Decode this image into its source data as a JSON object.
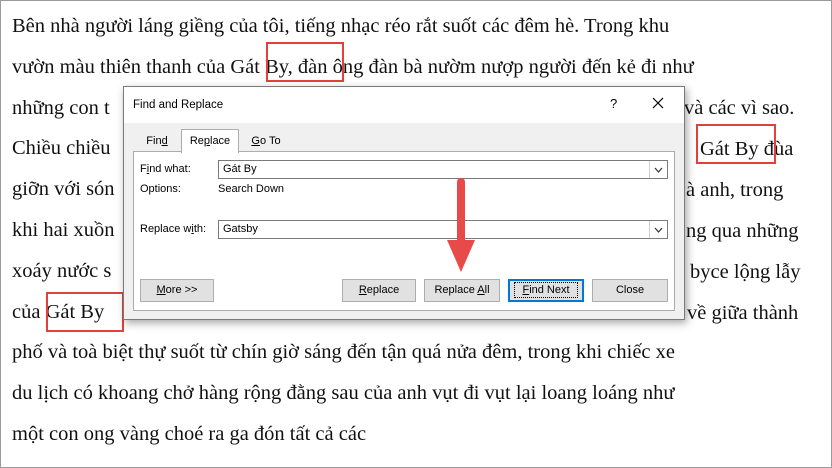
{
  "document": {
    "lines": [
      "Bên nhà người láng giềng của tôi, tiếng nhạc réo rắt suốt các đêm hè. Trong khu",
      "vườn màu thiên thanh của Gát By, đàn ông đàn bà nườm nượp người đến kẻ đi như",
      "những con t",
      "Chiều chiều",
      "giỡn với són",
      "khi hai xuồn",
      "xoáy nước s",
      "của Gát By",
      "phố và toà biệt thự suốt từ chín giờ sáng đến tận quá nửa đêm, trong khi chiếc xe",
      "du lịch có khoang chở hàng rộng đằng sau của anh vụt đi vụt lại loang loáng như",
      "một con ong vàng choé ra ga đón tất cả các"
    ],
    "right_fragments": [
      {
        "line": 2,
        "text": " và các vì sao."
      },
      {
        "line": 3,
        "text": "Gát By đùa"
      },
      {
        "line": 4,
        "text": "à anh, trong"
      },
      {
        "line": 5,
        "text": "ng qua những"
      },
      {
        "line": 6,
        "text": "byce lộng lẫy"
      },
      {
        "line": 7,
        "text": "về giữa thành"
      }
    ]
  },
  "dialog": {
    "title": "Find and Replace",
    "help": "?",
    "tabs": [
      {
        "pre": "Fin",
        "key": "d",
        "post": ""
      },
      {
        "pre": "Re",
        "key": "p",
        "post": "lace"
      },
      {
        "pre": "",
        "key": "G",
        "post": "o To"
      }
    ],
    "find_label": {
      "pre": "F",
      "key": "i",
      "post": "nd what:"
    },
    "find_value": "Gát By",
    "options_label": "Options:",
    "options_value": "Search Down",
    "replace_label": {
      "pre": "Replace w",
      "key": "i",
      "post": "th:"
    },
    "replace_value": "Gatsby",
    "buttons": {
      "more": {
        "pre": "",
        "key": "M",
        "post": "ore >>"
      },
      "replace": {
        "pre": "",
        "key": "R",
        "post": "eplace"
      },
      "replace_all": {
        "pre": "Replace ",
        "key": "A",
        "post": "ll"
      },
      "find_next": {
        "pre": "",
        "key": "F",
        "post": "ind Next"
      },
      "close": "Close"
    }
  },
  "colors": {
    "highlight": "#e0413a",
    "arrow": "#e84a4a",
    "accent": "#0078d7"
  }
}
